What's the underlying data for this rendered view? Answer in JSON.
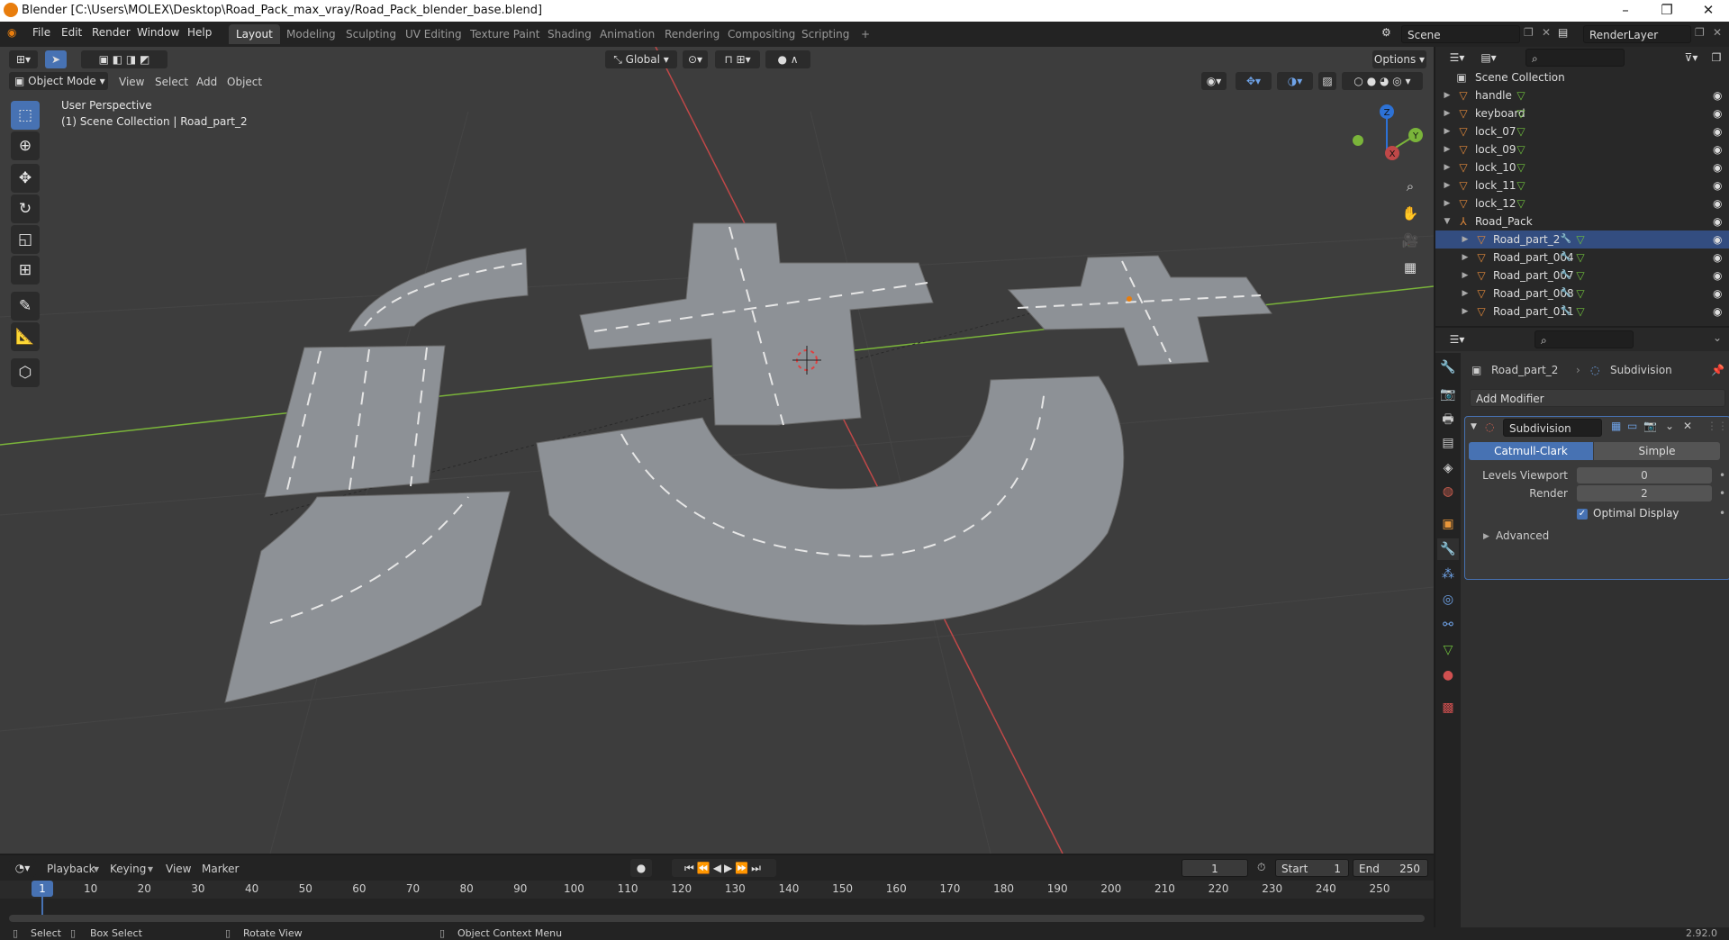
{
  "window": {
    "title": "Blender [C:\\Users\\MOLEX\\Desktop\\Road_Pack_max_vray/Road_Pack_blender_base.blend]",
    "controls": [
      "–",
      "❐",
      "✕"
    ]
  },
  "menu": [
    "File",
    "Edit",
    "Render",
    "Window",
    "Help"
  ],
  "workspaces": [
    "Layout",
    "Modeling",
    "Sculpting",
    "UV Editing",
    "Texture Paint",
    "Shading",
    "Animation",
    "Rendering",
    "Compositing",
    "Scripting"
  ],
  "active_workspace": "Layout",
  "scene": {
    "name": "Scene",
    "view_layer": "RenderLayer"
  },
  "viewport_header": {
    "mode": "Object Mode",
    "menus": [
      "View",
      "Select",
      "Add",
      "Object"
    ],
    "orientation": "Global",
    "options": "Options"
  },
  "viewport_overlay": {
    "line1": "User Perspective",
    "line2": "(1) Scene Collection | Road_part_2"
  },
  "gizmo": {
    "x": "X",
    "y": "Y",
    "z": "Z"
  },
  "outliner": {
    "root": "Scene Collection",
    "items": [
      {
        "name": "handle",
        "level": 1,
        "type": "mesh",
        "expanded": false
      },
      {
        "name": "keyboard",
        "level": 1,
        "type": "mesh",
        "expanded": false
      },
      {
        "name": "lock_07",
        "level": 1,
        "type": "mesh",
        "expanded": false
      },
      {
        "name": "lock_09",
        "level": 1,
        "type": "mesh",
        "expanded": false
      },
      {
        "name": "lock_10",
        "level": 1,
        "type": "mesh",
        "expanded": false
      },
      {
        "name": "lock_11",
        "level": 1,
        "type": "mesh",
        "expanded": false
      },
      {
        "name": "lock_12",
        "level": 1,
        "type": "mesh",
        "expanded": false
      },
      {
        "name": "Road_Pack",
        "level": 1,
        "type": "empty",
        "expanded": true
      },
      {
        "name": "Road_part_2",
        "level": 2,
        "type": "mesh",
        "expanded": false,
        "selected": true
      },
      {
        "name": "Road_part_004",
        "level": 2,
        "type": "mesh",
        "expanded": false
      },
      {
        "name": "Road_part_007",
        "level": 2,
        "type": "mesh",
        "expanded": false
      },
      {
        "name": "Road_part_008",
        "level": 2,
        "type": "mesh",
        "expanded": false
      },
      {
        "name": "Road_part_011",
        "level": 2,
        "type": "mesh",
        "expanded": false
      }
    ]
  },
  "properties": {
    "object": "Road_part_2",
    "modifier_breadcrumb": "Subdivision",
    "add_modifier": "Add Modifier",
    "modifier": {
      "name": "Subdivision",
      "tabs": [
        "Catmull-Clark",
        "Simple"
      ],
      "active_tab": "Catmull-Clark",
      "levels_viewport_label": "Levels Viewport",
      "levels_viewport": "0",
      "render_label": "Render",
      "render": "2",
      "optimal_display_label": "Optimal Display",
      "optimal_display": true,
      "advanced": "Advanced"
    }
  },
  "timeline": {
    "menus": [
      "Playback",
      "Keying",
      "View",
      "Marker"
    ],
    "current_frame": "1",
    "start_label": "Start",
    "start": "1",
    "end_label": "End",
    "end": "250",
    "ticks": [
      "1",
      "10",
      "20",
      "30",
      "40",
      "50",
      "60",
      "70",
      "80",
      "90",
      "100",
      "110",
      "120",
      "130",
      "140",
      "150",
      "160",
      "170",
      "180",
      "190",
      "200",
      "210",
      "220",
      "230",
      "240",
      "250"
    ]
  },
  "status": {
    "select": "Select",
    "box_select": "Box Select",
    "rotate_view": "Rotate View",
    "context_menu": "Object Context Menu",
    "version": "2.92.0"
  },
  "colors": {
    "accent": "#4772b3",
    "selected_row": "#334d80",
    "mesh_icon": "#e0883a",
    "data_icon": "#6fbf3c",
    "axis_x": "#c04848",
    "axis_y": "#7ab43a",
    "axis_z": "#2d72d6",
    "road": "#8d9196"
  }
}
